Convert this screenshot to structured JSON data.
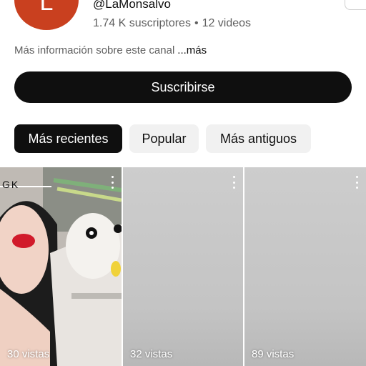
{
  "channel": {
    "avatar_letter": "L",
    "avatar_color": "#c9401f",
    "handle": "@LaMonsalvo",
    "subscribers": "1.74 K suscriptores",
    "separator": "•",
    "videos": "12 videos",
    "about_text": "Más información sobre este canal",
    "about_more": "...más"
  },
  "subscribe": {
    "label": "Suscribirse"
  },
  "filters": {
    "chips": [
      {
        "label": "Más recientes",
        "active": true
      },
      {
        "label": "Popular",
        "active": false
      },
      {
        "label": "Más antiguos",
        "active": false
      }
    ]
  },
  "shorts": [
    {
      "views": "30 vistas",
      "thumb_caption": "GK"
    },
    {
      "views": "32 vistas"
    },
    {
      "views": "89 vistas"
    }
  ],
  "icons": [
    "more-vert-icon"
  ],
  "colors": {
    "primary": "#0f0f0f",
    "chip_bg": "#f1f1f1",
    "secondary_text": "#606060",
    "placeholder_tile": "#c7c7c7"
  }
}
